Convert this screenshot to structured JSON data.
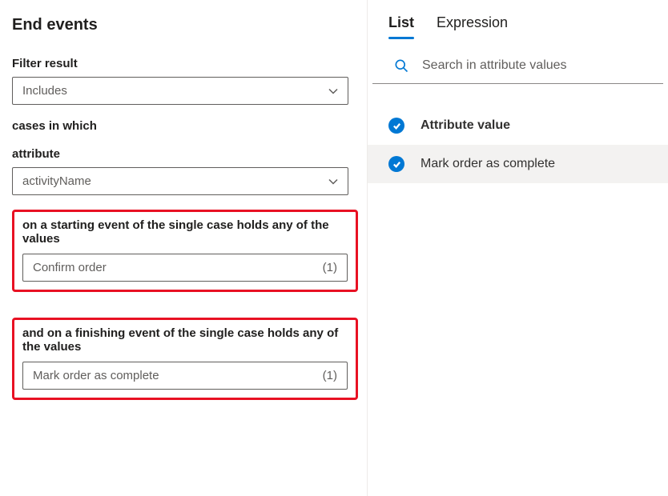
{
  "title": "End events",
  "left": {
    "filter_result_label": "Filter result",
    "filter_result_value": "Includes",
    "cases_in_which": "cases in which",
    "attribute_label": "attribute",
    "attribute_value": "activityName",
    "starting_sentence": "on a starting event of the single case holds any of the values",
    "starting_value": "Confirm order",
    "starting_count": "(1)",
    "finishing_sentence": "and on a finishing event of the single case holds any of the values",
    "finishing_value": "Mark order as complete",
    "finishing_count": "(1)"
  },
  "right": {
    "tabs": {
      "list": "List",
      "expression": "Expression"
    },
    "search_placeholder": "Search in attribute values",
    "header": "Attribute value",
    "items": [
      {
        "label": "Mark order as complete"
      }
    ]
  }
}
